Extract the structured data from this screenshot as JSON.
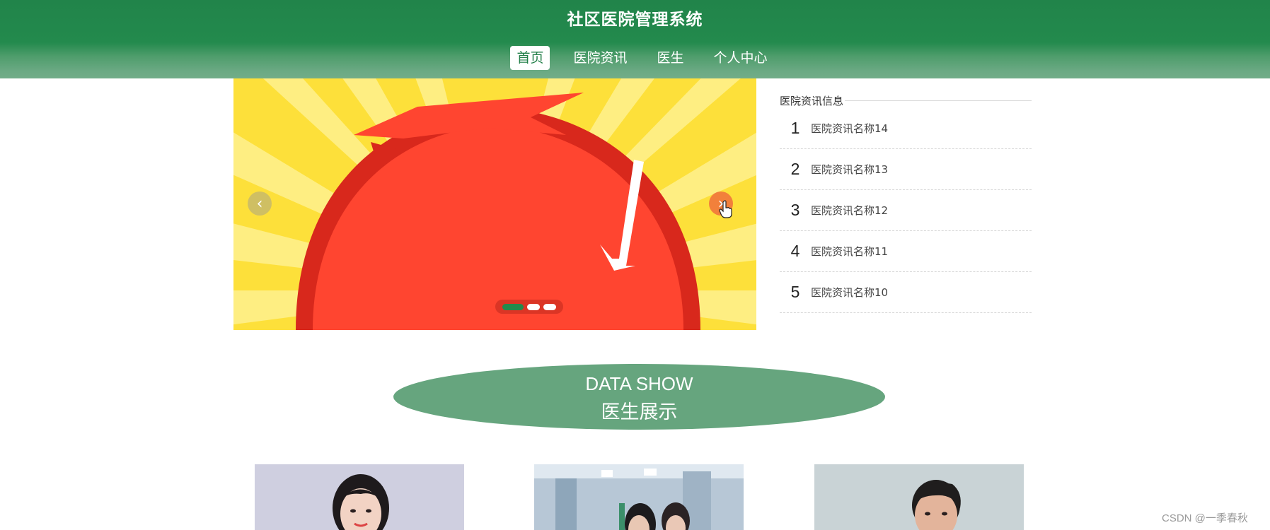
{
  "header": {
    "title": "社区医院管理系统",
    "nav": [
      {
        "label": "首页",
        "active": true
      },
      {
        "label": "医院资讯",
        "active": false
      },
      {
        "label": "医生",
        "active": false
      },
      {
        "label": "个人中心",
        "active": false
      }
    ]
  },
  "carousel": {
    "prev_icon": "chevron-left-icon",
    "next_icon": "chevron-right-icon",
    "prev_glyph": "‹",
    "next_glyph": "›",
    "slide_count": 3,
    "active_slide": 1,
    "colors": {
      "background": "#fde03a",
      "blob": "#ff4530",
      "indicator_active": "#228a4c"
    }
  },
  "news": {
    "title": "医院资讯信息",
    "items": [
      {
        "num": "1",
        "name": "医院资讯名称14"
      },
      {
        "num": "2",
        "name": "医院资讯名称13"
      },
      {
        "num": "3",
        "name": "医院资讯名称12"
      },
      {
        "num": "4",
        "name": "医院资讯名称11"
      },
      {
        "num": "5",
        "name": "医院资讯名称10"
      }
    ]
  },
  "section": {
    "title_en": "DATA SHOW",
    "title_zh": "医生展示"
  },
  "doctors": [
    {
      "image": "female-doctor-photo"
    },
    {
      "image": "dental-clinic-photo"
    },
    {
      "image": "male-doctor-photo"
    }
  ],
  "watermark": "CSDN @一季春秋",
  "colors": {
    "primary": "#21844a",
    "section": "#66a57e"
  }
}
